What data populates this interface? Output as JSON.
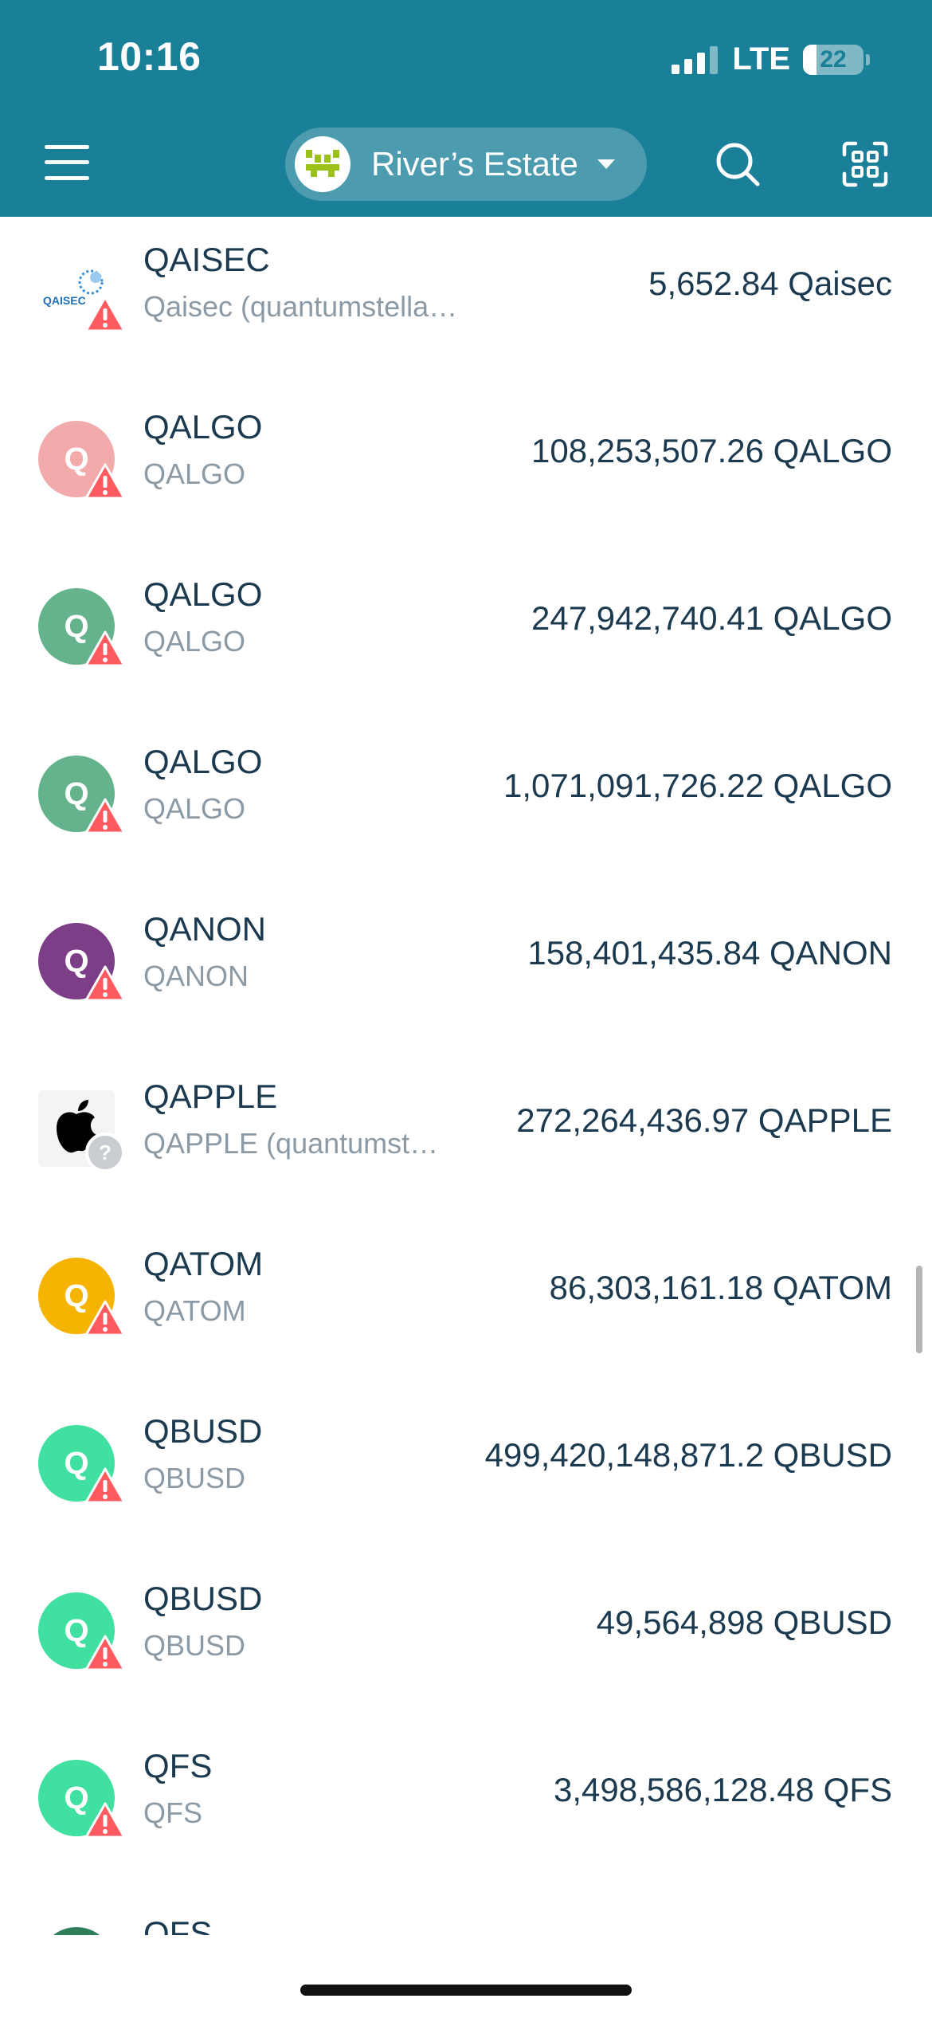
{
  "status_bar": {
    "time": "10:16",
    "network": "LTE",
    "battery": "22",
    "battery_level": 0.22
  },
  "header": {
    "wallet_name": "River’s Estate"
  },
  "assets": [
    {
      "symbol": "QAISEC",
      "name": "Qaisec (quantumstellar.ai)",
      "amount": "5,652.84 Qaisec",
      "logo_letter": "",
      "logo_color": "#ffffff",
      "badge": "warning",
      "logo_text": "QAISEC"
    },
    {
      "symbol": "QALGO",
      "name": "QALGO",
      "amount": "108,253,507.26 QALGO",
      "logo_letter": "Q",
      "logo_color": "#f2aaaa",
      "badge": "warning"
    },
    {
      "symbol": "QALGO",
      "name": "QALGO",
      "amount": "247,942,740.41 QALGO",
      "logo_letter": "Q",
      "logo_color": "#64b38c",
      "badge": "warning"
    },
    {
      "symbol": "QALGO",
      "name": "QALGO",
      "amount": "1,071,091,726.22 QALGO",
      "logo_letter": "Q",
      "logo_color": "#64b38c",
      "badge": "warning"
    },
    {
      "symbol": "QANON",
      "name": "QANON",
      "amount": "158,401,435.84 QANON",
      "logo_letter": "Q",
      "logo_color": "#7b3e87",
      "badge": "warning"
    },
    {
      "symbol": "QAPPLE",
      "name": "QAPPLE (quantumst…",
      "amount": "272,264,436.97 QAPPLE",
      "logo_letter": "",
      "logo_color": "#f4f4f4",
      "badge": "unknown"
    },
    {
      "symbol": "QATOM",
      "name": "QATOM",
      "amount": "86,303,161.18 QATOM",
      "logo_letter": "Q",
      "logo_color": "#f4b400",
      "badge": "warning"
    },
    {
      "symbol": "QBUSD",
      "name": "QBUSD",
      "amount": "499,420,148,871.2 QBUSD",
      "logo_letter": "Q",
      "logo_color": "#3fe0a0",
      "badge": "warning"
    },
    {
      "symbol": "QBUSD",
      "name": "QBUSD",
      "amount": "49,564,898 QBUSD",
      "logo_letter": "Q",
      "logo_color": "#3fe0a0",
      "badge": "warning"
    },
    {
      "symbol": "QFS",
      "name": "QFS",
      "amount": "3,498,586,128.48 QFS",
      "logo_letter": "Q",
      "logo_color": "#3fe0a0",
      "badge": "warning"
    },
    {
      "symbol": "QFS",
      "name": "",
      "amount": "",
      "logo_letter": "",
      "logo_color": "#2e7d5b",
      "badge": ""
    }
  ]
}
